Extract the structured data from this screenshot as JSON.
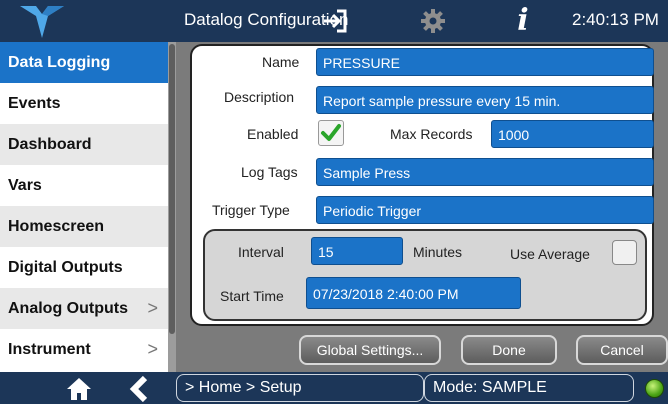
{
  "header": {
    "title": "Datalog Configuration",
    "clock": "2:40:13 PM",
    "icons": [
      "logo-icon",
      "exit-icon",
      "gear-icon",
      "info-icon"
    ]
  },
  "sidebar": {
    "items": [
      {
        "label": "Data Logging",
        "active": true,
        "chevron": ""
      },
      {
        "label": "Events",
        "active": false,
        "chevron": ""
      },
      {
        "label": "Dashboard",
        "active": false,
        "chevron": ""
      },
      {
        "label": "Vars",
        "active": false,
        "chevron": ""
      },
      {
        "label": "Homescreen",
        "active": false,
        "chevron": ""
      },
      {
        "label": "Digital Outputs",
        "active": false,
        "chevron": ""
      },
      {
        "label": "Analog Outputs",
        "active": false,
        "chevron": ">"
      },
      {
        "label": "Instrument",
        "active": false,
        "chevron": ">"
      }
    ]
  },
  "form": {
    "name_label": "Name",
    "name_value": "PRESSURE",
    "description_label": "Description",
    "description_value": "Report sample pressure every 15 min.",
    "enabled_label": "Enabled",
    "enabled": true,
    "max_records_label": "Max Records",
    "max_records_value": "1000",
    "log_tags_label": "Log Tags",
    "log_tags_value": "Sample Press",
    "trigger_type_label": "Trigger Type",
    "trigger_type_value": "Periodic Trigger",
    "interval_label": "Interval",
    "interval_value": "15",
    "interval_unit": "Minutes",
    "use_average_label": "Use Average",
    "use_average": false,
    "start_time_label": "Start Time",
    "start_time_value": "07/23/2018 2:40:00 PM"
  },
  "buttons": {
    "global_settings": "Global Settings...",
    "done": "Done",
    "cancel": "Cancel"
  },
  "footer": {
    "breadcrumb": "> Home > Setup",
    "mode": "Mode: SAMPLE",
    "status_color": "#4ba415"
  },
  "colors": {
    "accent": "#1b73c8",
    "chrome": "#1c3658"
  }
}
